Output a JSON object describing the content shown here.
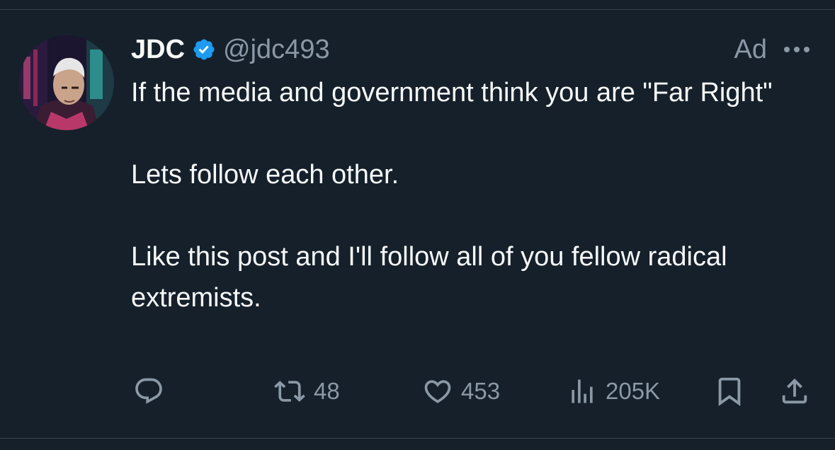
{
  "post": {
    "author": {
      "display_name": "JDC",
      "handle": "@jdc493",
      "verified": true,
      "verified_color": "#1d9bf0"
    },
    "ad_label": "Ad",
    "text": "If the media and government think you are  \"Far Right\"\n\nLets follow each other.\n\nLike this post and I'll follow all of you fellow radical extremists.",
    "actions": {
      "reply": {
        "icon": "reply-icon"
      },
      "repost": {
        "icon": "repost-icon",
        "count": "48"
      },
      "like": {
        "icon": "heart-icon",
        "count": "453"
      },
      "views": {
        "icon": "views-icon",
        "count": "205K"
      },
      "bookmark": {
        "icon": "bookmark-icon"
      },
      "share": {
        "icon": "share-icon"
      }
    }
  },
  "colors": {
    "background": "#15202b",
    "primary_text": "#f7f9f9",
    "secondary_text": "#8b98a5",
    "divider": "#38444d"
  }
}
